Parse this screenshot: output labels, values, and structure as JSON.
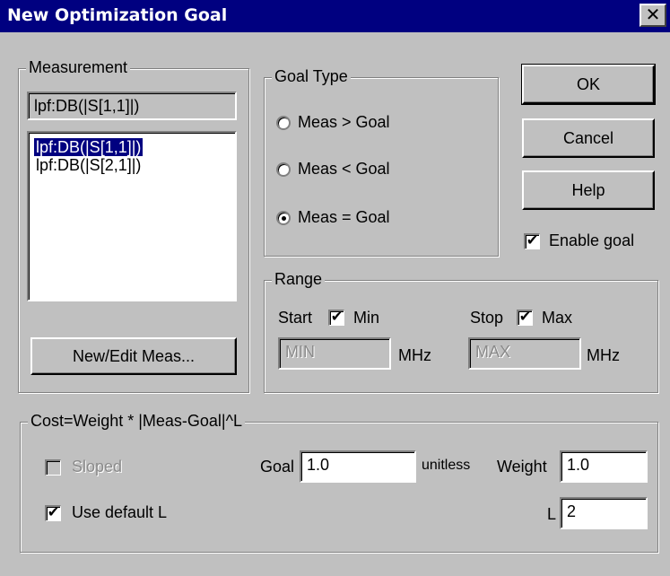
{
  "window": {
    "title": "New Optimization Goal",
    "close_glyph": "✕"
  },
  "measurement": {
    "legend": "Measurement",
    "current": "lpf:DB(|S[1,1]|)",
    "list": [
      "lpf:DB(|S[1,1]|)",
      "lpf:DB(|S[2,1]|)"
    ],
    "selected_index": 0,
    "new_edit_label": "New/Edit Meas..."
  },
  "goal_type": {
    "legend": "Goal Type",
    "options": [
      "Meas > Goal",
      "Meas < Goal",
      "Meas = Goal"
    ],
    "selected": "Meas = Goal"
  },
  "buttons": {
    "ok": "OK",
    "cancel": "Cancel",
    "help": "Help"
  },
  "enable_goal": {
    "label": "Enable goal",
    "checked": true
  },
  "range": {
    "legend": "Range",
    "start_label": "Start",
    "min_label": "Min",
    "min_checked": true,
    "stop_label": "Stop",
    "max_label": "Max",
    "max_checked": true,
    "start_value": "MIN",
    "stop_value": "MAX",
    "start_unit": "MHz",
    "stop_unit": "MHz"
  },
  "cost": {
    "legend": "Cost=Weight * |Meas-Goal|^L",
    "sloped_label": "Sloped",
    "sloped_checked": false,
    "sloped_enabled": false,
    "use_default_l_label": "Use default L",
    "use_default_l_checked": true,
    "goal_label": "Goal",
    "goal_value": "1.0",
    "goal_unit": "unitless",
    "weight_label": "Weight",
    "weight_value": "1.0",
    "l_label": "L",
    "l_value": "2"
  }
}
